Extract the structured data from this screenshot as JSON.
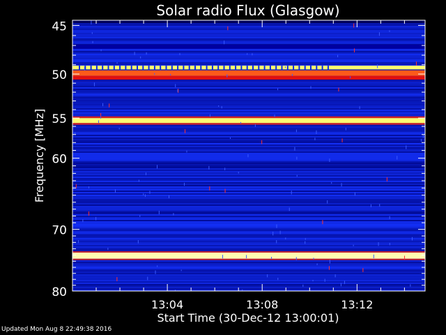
{
  "chart_data": {
    "type": "heatmap",
    "title": "Solar radio Flux (Glasgow)",
    "ylabel": "Frequency [MHz]",
    "xlabel": "Start Time (30-Dec-12 13:00:01)",
    "ylim": [
      44.5,
      80
    ],
    "xlim_minutes": [
      0,
      14.87
    ],
    "y_scale": "log",
    "y_ticks": [
      45,
      50,
      55,
      60,
      70,
      80
    ],
    "y_tick_labels": [
      "45",
      "50",
      "55",
      "60",
      "70",
      "80"
    ],
    "x_ticks_minutes": [
      4,
      8,
      12
    ],
    "x_tick_labels": [
      "13:04",
      "13:08",
      "13:12"
    ],
    "colormap": [
      "#000000",
      "#0000ff",
      "#ff0000",
      "#ffff66",
      "#ffffff"
    ],
    "background_level": "blue",
    "bright_bands": [
      {
        "freq_mhz": [
          49.1,
          49.5
        ],
        "level": "yellow"
      },
      {
        "freq_mhz": [
          49.6,
          50.2
        ],
        "level": "red-orange"
      },
      {
        "freq_mhz": [
          50.2,
          50.6
        ],
        "level": "red"
      },
      {
        "freq_mhz": [
          55.0,
          55.6
        ],
        "level": "yellow"
      },
      {
        "freq_mhz": [
          73.6,
          74.6
        ],
        "level": "yellow-white"
      }
    ]
  },
  "footer": {
    "updated": "Updated Mon Aug  8 22:49:38 2016"
  }
}
